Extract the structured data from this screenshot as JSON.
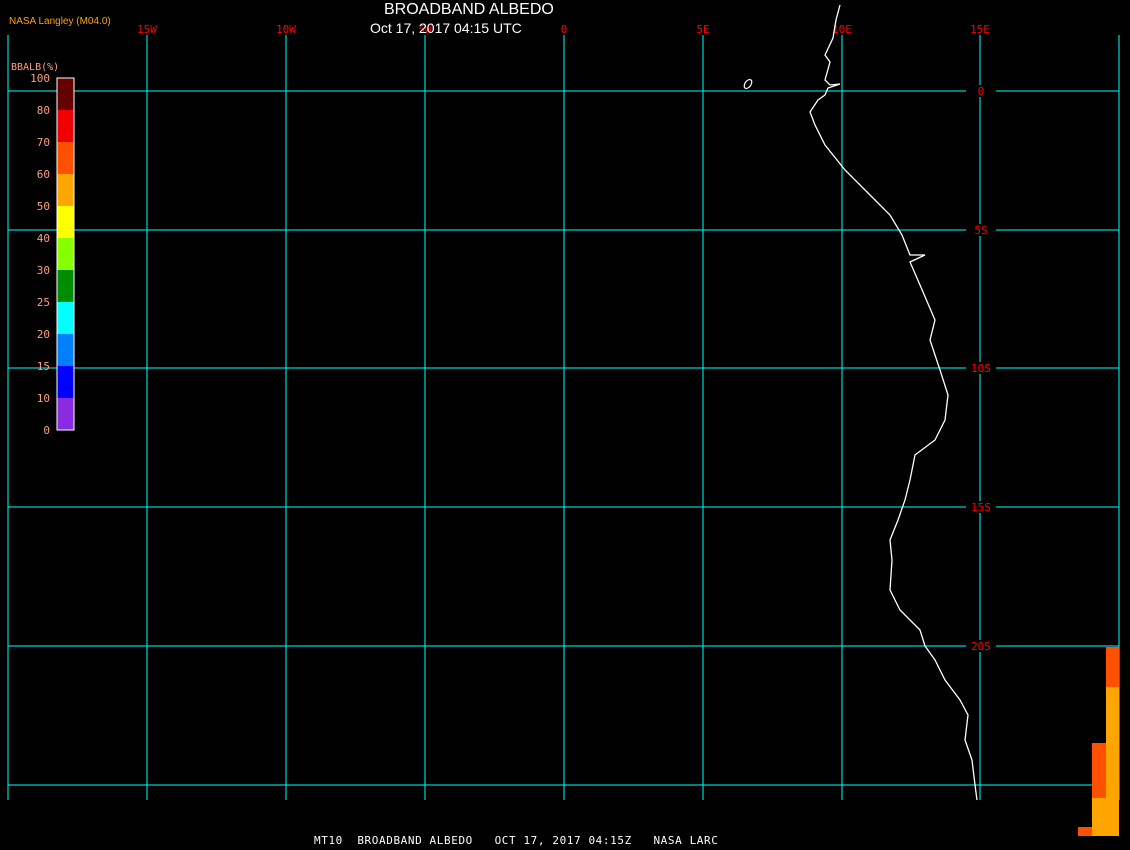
{
  "header": {
    "title": "BROADBAND ALBEDO",
    "subtitle": "Oct 17, 2017 04:15 UTC",
    "brand": "NASA Langley (M04.0)"
  },
  "footer": {
    "text": "MT10  BROADBAND ALBEDO   OCT 17, 2017 04:15Z   NASA LARC"
  },
  "map": {
    "longitude_labels": [
      "15W",
      "10W",
      "5W",
      "0",
      "5E",
      "10E",
      "15E"
    ],
    "latitude_labels": [
      "0",
      "5S",
      "10S",
      "15S",
      "20S"
    ],
    "grid_color": "#00ffff",
    "label_color": "#ff0000",
    "coastline_color": "#ffffff"
  },
  "colorbar": {
    "title": "BBALB(%)",
    "tick_labels": [
      "100",
      "80",
      "70",
      "60",
      "50",
      "40",
      "30",
      "25",
      "20",
      "15",
      "10",
      "0"
    ],
    "colors": [
      "#640000",
      "#f00000",
      "#ff5000",
      "#ffa500",
      "#ffff00",
      "#88ff00",
      "#008c00",
      "#00ffff",
      "#0080ff",
      "#0000ff",
      "#8a2be2"
    ]
  }
}
